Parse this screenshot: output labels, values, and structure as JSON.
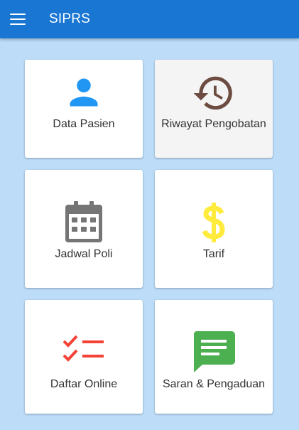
{
  "appbar": {
    "title": "SIPRS",
    "menu_icon": "hamburger-menu-icon"
  },
  "menu": [
    {
      "label": "Data Pasien",
      "icon": "person-icon",
      "color": "#2196f3"
    },
    {
      "label": "Riwayat Pengobatan",
      "icon": "history-icon",
      "color": "#6d4c41"
    },
    {
      "label": "Jadwal Poli",
      "icon": "calendar-icon",
      "color": "#757575"
    },
    {
      "label": "Tarif",
      "icon": "dollar-icon",
      "color": "#ffeb3b"
    },
    {
      "label": "Daftar Online",
      "icon": "checklist-icon",
      "color": "#f44336"
    },
    {
      "label": "Saran & Pengaduan",
      "icon": "feedback-chat-icon",
      "color": "#4caf50"
    }
  ],
  "colors": {
    "appbar": "#1976d2",
    "background": "#bcdcf8"
  }
}
